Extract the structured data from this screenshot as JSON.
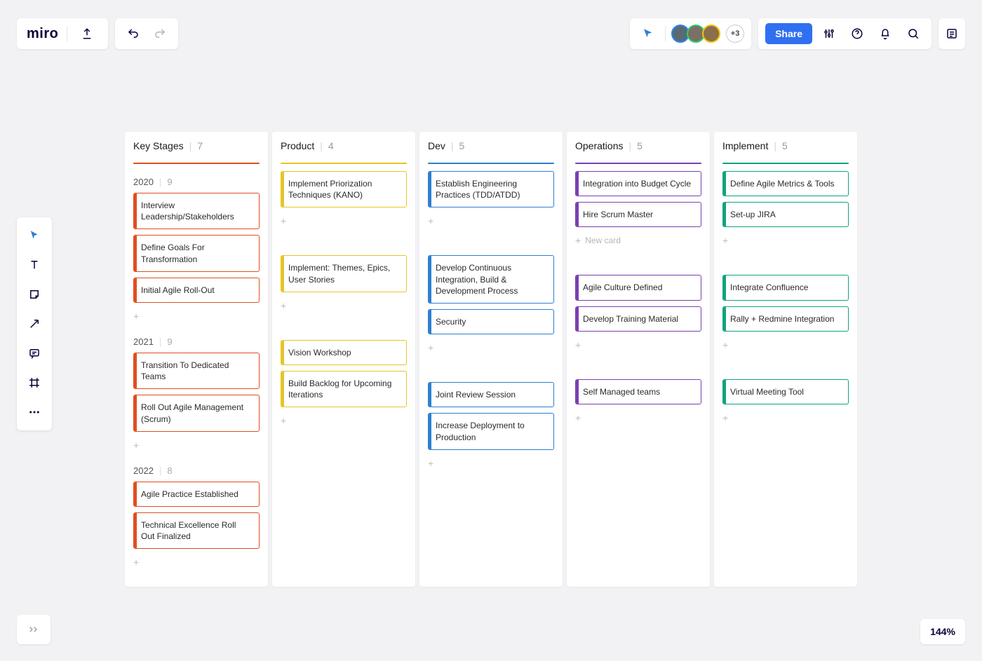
{
  "brand": "miro",
  "share_label": "Share",
  "more_users_label": "+3",
  "zoom": "144%",
  "new_card_label": "New card",
  "avatars": [
    {
      "bg": "#5a6a72",
      "ring": "#2f80ed"
    },
    {
      "bg": "#7a7065",
      "ring": "#2ecc71"
    },
    {
      "bg": "#8a6f4a",
      "ring": "#f1c40f"
    }
  ],
  "columns": [
    {
      "title": "Key Stages",
      "count": "7",
      "color": "#e04e1f"
    },
    {
      "title": "Product",
      "count": "4",
      "color": "#e7c427"
    },
    {
      "title": "Dev",
      "count": "5",
      "color": "#2d7fd1"
    },
    {
      "title": "Operations",
      "count": "5",
      "color": "#7b3fb0"
    },
    {
      "title": "Implement",
      "count": "5",
      "color": "#0fa37f"
    }
  ],
  "rows": [
    {
      "label": "2020",
      "count": "9"
    },
    {
      "label": "2021",
      "count": "9"
    },
    {
      "label": "2022",
      "count": "8"
    }
  ],
  "cards": {
    "0": {
      "0": [
        "Interview Leadership/Stakeholders",
        "Define Goals For Transformation",
        "Initial Agile Roll-Out"
      ],
      "1": [
        "Transition To Dedicated Teams",
        "Roll Out Agile Management (Scrum)"
      ],
      "2": [
        "Agile Practice Established",
        "Technical Excellence Roll Out Finalized"
      ]
    },
    "1": {
      "0": [
        "Implement Priorization Techniques (KANO)"
      ],
      "1": [
        "Implement: Themes, Epics, User Stories"
      ],
      "2": [
        "Vision Workshop",
        "Build Backlog for Upcoming Iterations"
      ]
    },
    "2": {
      "0": [
        "Establish Engineering Practices (TDD/ATDD)"
      ],
      "1": [
        "Develop Continuous Integration, Build & Development Process",
        "Security"
      ],
      "2": [
        "Joint Review Session",
        "Increase Deployment to Production"
      ]
    },
    "3": {
      "0": [
        "Integration into Budget Cycle",
        "Hire Scrum Master"
      ],
      "1": [
        "Agile Culture Defined",
        "Develop Training Material"
      ],
      "2": [
        "Self Managed teams"
      ]
    },
    "4": {
      "0": [
        "Define Agile Metrics & Tools",
        "Set-up JIRA"
      ],
      "1": [
        "Integrate Confluence",
        "Rally + Redmine Integration"
      ],
      "2": [
        "Virtual Meeting Tool"
      ]
    }
  },
  "add_card_labeled": {
    "col": 3,
    "row": 0
  }
}
